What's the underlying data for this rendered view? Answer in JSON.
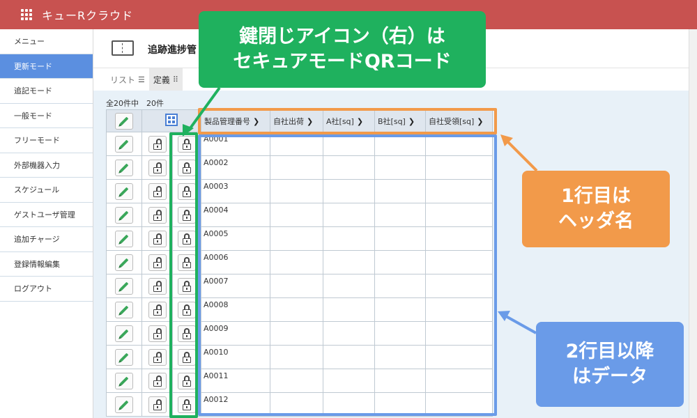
{
  "app": {
    "title": "キューRクラウド"
  },
  "sidebar": {
    "items": [
      {
        "label": "メニュー",
        "active": false
      },
      {
        "label": "更新モード",
        "active": true
      },
      {
        "label": "追記モード",
        "active": false
      },
      {
        "label": "一般モード",
        "active": false
      },
      {
        "label": "フリーモード",
        "active": false
      },
      {
        "label": "外部機器入力",
        "active": false
      },
      {
        "label": "スケジュール",
        "active": false
      },
      {
        "label": "ゲストユーザ管理",
        "active": false
      },
      {
        "label": "追加チャージ",
        "active": false
      },
      {
        "label": "登録情報編集",
        "active": false
      },
      {
        "label": "ログアウト",
        "active": false
      }
    ]
  },
  "page": {
    "title": "追跡進捗管"
  },
  "tabs": [
    {
      "label": "リスト",
      "icon": "list-icon",
      "active": false
    },
    {
      "label": "定義",
      "icon": "grid-icon",
      "active": true
    }
  ],
  "count": {
    "text": "全20件中　20件"
  },
  "grid": {
    "headers": [
      "製品管理番号",
      "自社出荷",
      "A社[sq]",
      "B社[sq]",
      "自社受領[sq]"
    ],
    "rows": [
      "A0001",
      "A0002",
      "A0003",
      "A0004",
      "A0005",
      "A0006",
      "A0007",
      "A0008",
      "A0009",
      "A0010",
      "A0011",
      "A0012"
    ]
  },
  "annotations": {
    "green": {
      "line1": "鍵閉じアイコン（右）は",
      "line2": "セキュアモードQRコード",
      "color": "#1fb15e"
    },
    "orange": {
      "line1": "1行目は",
      "line2": "ヘッダ名",
      "color": "#f29a4a"
    },
    "blue": {
      "line1": "2行目以降",
      "line2": "はデータ",
      "color": "#6a9be8"
    }
  },
  "colors": {
    "topbar": "#c85250",
    "sidebar_active": "#5b8fe0",
    "content_bg": "#e8f1f8"
  }
}
